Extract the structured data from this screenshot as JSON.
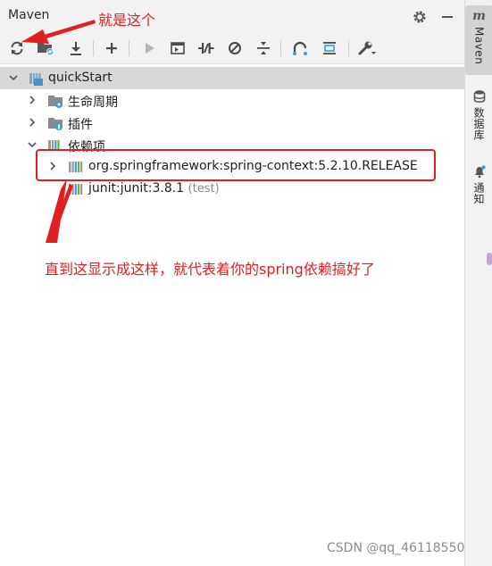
{
  "window": {
    "title": "Maven",
    "title_actions": [
      {
        "name": "settings-gear-icon"
      },
      {
        "name": "hide-panel-icon"
      }
    ]
  },
  "toolbar": {
    "buttons": [
      {
        "name": "reload-all-projects-button",
        "icon": "sync-icon"
      },
      {
        "name": "generate-sources-button",
        "icon": "folder-sync-icon"
      },
      {
        "name": "download-sources-button",
        "icon": "download-icon"
      },
      {
        "name": "add-maven-project-button",
        "icon": "plus-icon"
      },
      {
        "name": "run-maven-build-button",
        "icon": "play-icon"
      },
      {
        "name": "execute-maven-goal-button",
        "icon": "terminal-icon"
      },
      {
        "name": "toggle-offline-mode-button",
        "icon": "offline-icon"
      },
      {
        "name": "skip-tests-button",
        "icon": "skip-tests-icon"
      },
      {
        "name": "collapse-all-button",
        "icon": "collapse-icon"
      },
      {
        "name": "show-dependencies-button",
        "icon": "dependencies-icon"
      },
      {
        "name": "expand-all-button",
        "icon": "expand-icon"
      },
      {
        "name": "build-tool-settings-button",
        "icon": "wrench-icon"
      }
    ]
  },
  "tree": {
    "project": "quickStart",
    "lifecycle": "生命周期",
    "plugins": "插件",
    "dependencies": "依赖项",
    "dep_items": [
      {
        "label": "org.springframework:spring-context:5.2.10.RELEASE",
        "suffix": ""
      },
      {
        "label": "junit:junit:3.8.1",
        "suffix": "(test)"
      }
    ]
  },
  "side_strip": {
    "maven": "Maven",
    "database": "数据库",
    "notifications": "通知"
  },
  "annotations": {
    "top_note": "就是这个",
    "bottom_note": "直到这显示成这样，就代表着你的spring依赖搞好了",
    "color": "#e02020"
  },
  "watermark": "CSDN @qq_46118550"
}
